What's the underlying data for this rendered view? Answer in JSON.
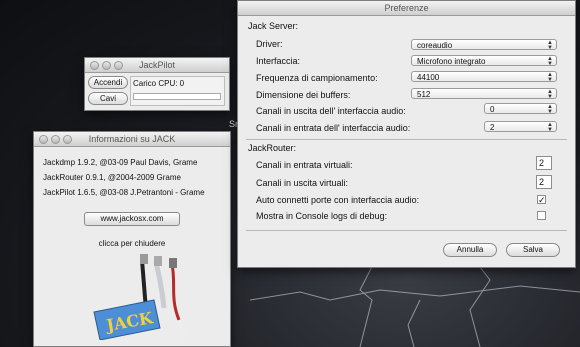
{
  "preferences": {
    "title": "Preferenze",
    "jack_server_header": "Jack Server:",
    "rows": [
      {
        "label": "Driver:",
        "value": "coreaudio"
      },
      {
        "label": "Interfaccia:",
        "value": "Microfono integrato"
      },
      {
        "label": "Frequenza di campionamento:",
        "value": "44100"
      },
      {
        "label": "Dimensione dei buffers:",
        "value": "512"
      },
      {
        "label": "Canali in uscita dell' interfaccia audio:",
        "value": "0"
      },
      {
        "label": "Canali in entrata dell' interfaccia audio:",
        "value": "2"
      }
    ],
    "jack_router_header": "JackRouter:",
    "virtual_in_label": "Canali in entrata virtuali:",
    "virtual_in_value": "2",
    "virtual_out_label": "Canali in uscita virtuali:",
    "virtual_out_value": "2",
    "autoconnect_label": "Auto connetti porte con interfaccia audio:",
    "autoconnect_checked": true,
    "autoconnect_mark": "✓",
    "debug_label": "Mostra in Console logs di debug:",
    "debug_checked": false,
    "cancel_label": "Annulla",
    "save_label": "Salva"
  },
  "jackpilot": {
    "title": "JackPilot",
    "start_label": "Accendi",
    "routing_label": "Cavi",
    "cpu_label": "Carico CPU: 0",
    "cpu_load": 0
  },
  "info": {
    "title": "Informazioni su JACK",
    "lines": [
      "Jackdmp 1.9.2, @03-09 Paul Davis, Grame",
      "JackRouter 0.9.1, @2004-2009 Grame",
      "JackPilot 1.6.5, @03-08 J.Petrantoni - Grame"
    ],
    "url_button": "www.jackosx.com",
    "close_hint": "clicca per chiudere",
    "logo_text": "JACK"
  },
  "desktop_label_fragment": "Sn"
}
